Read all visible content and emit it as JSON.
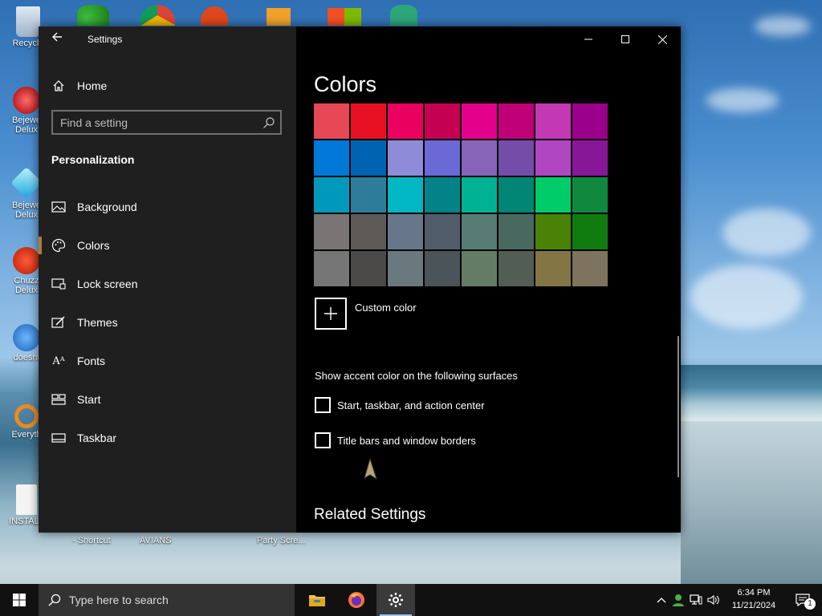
{
  "desktop": {
    "icons": [
      {
        "name": "recycle-bin",
        "label": "Recycle"
      },
      {
        "name": "bejeweled-2",
        "label": "Bejewe Delux"
      },
      {
        "name": "bejeweled-3",
        "label": "Bejewe Delux"
      },
      {
        "name": "chuzzle",
        "label": "Chuzz Delux"
      },
      {
        "name": "doesnt",
        "label": "doesnt"
      },
      {
        "name": "everything",
        "label": "Everyth"
      },
      {
        "name": "install",
        "label": "INSTALL"
      }
    ],
    "bottom_labels": [
      "- Shortcut",
      "AVIANS",
      "Party Scre..."
    ]
  },
  "window": {
    "title": "Settings",
    "sidebar": {
      "home_label": "Home",
      "search_placeholder": "Find a setting",
      "section_title": "Personalization",
      "items": [
        {
          "label": "Background",
          "icon": "picture-icon",
          "active": false
        },
        {
          "label": "Colors",
          "icon": "palette-icon",
          "active": true
        },
        {
          "label": "Lock screen",
          "icon": "lock-screen-icon",
          "active": false
        },
        {
          "label": "Themes",
          "icon": "themes-icon",
          "active": false
        },
        {
          "label": "Fonts",
          "icon": "fonts-icon",
          "active": false
        },
        {
          "label": "Start",
          "icon": "start-icon",
          "active": false
        },
        {
          "label": "Taskbar",
          "icon": "taskbar-icon",
          "active": false
        }
      ]
    },
    "content": {
      "page_title": "Colors",
      "swatches": [
        "#e74856",
        "#e81123",
        "#ea005e",
        "#c30052",
        "#e3008c",
        "#bf0077",
        "#c239b3",
        "#9a0089",
        "#0078d7",
        "#0063b1",
        "#8e8cd8",
        "#6b69d6",
        "#8764b8",
        "#744da9",
        "#b146c2",
        "#881798",
        "#0099bc",
        "#2d7d9a",
        "#00b7c3",
        "#038387",
        "#00b294",
        "#018574",
        "#00cc6a",
        "#10893e",
        "#7a7574",
        "#5d5a58",
        "#68768a",
        "#515c6b",
        "#567c73",
        "#486860",
        "#498205",
        "#107c10",
        "#767676",
        "#4c4a48",
        "#69797e",
        "#4a5459",
        "#647c64",
        "#525e54",
        "#847545",
        "#7e735f"
      ],
      "custom_color_label": "Custom color",
      "surfaces_title": "Show accent color on the following surfaces",
      "checkboxes": [
        {
          "label": "Start, taskbar, and action center",
          "checked": false
        },
        {
          "label": "Title bars and window borders",
          "checked": false
        }
      ],
      "related_title": "Related Settings"
    }
  },
  "taskbar": {
    "search_placeholder": "Type here to search",
    "time": "6:34 PM",
    "date": "11/21/2024",
    "notification_count": "1"
  }
}
